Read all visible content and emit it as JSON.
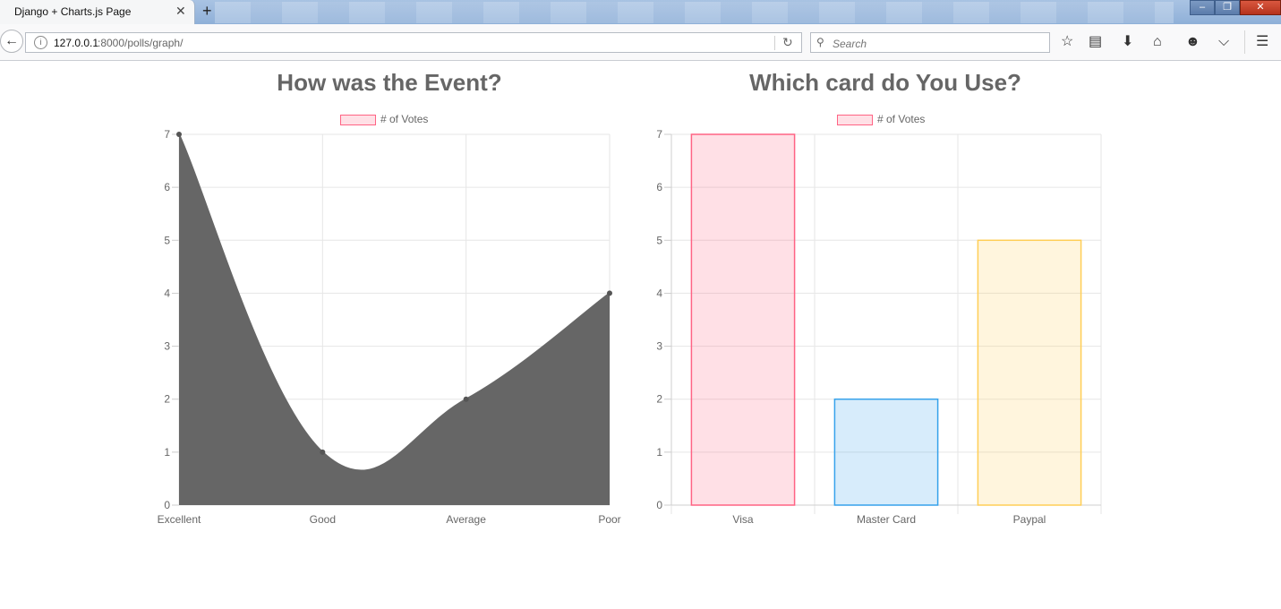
{
  "browser": {
    "tab_title": "Django + Charts.js Page",
    "tab_close": "✕",
    "new_tab": "+",
    "url_host": "127.0.0.1",
    "url_rest": ":8000/polls/graph/",
    "search_placeholder": "Search",
    "window_buttons": {
      "minimize": "–",
      "restore": "❐",
      "close": "✕"
    }
  },
  "icons": {
    "back": "back-arrow-icon",
    "info": "info-icon",
    "reload": "reload-icon",
    "search": "search-icon",
    "bookmark": "star-icon",
    "reading_list": "clipboard-icon",
    "download": "download-arrow-icon",
    "home": "home-icon",
    "hello": "smiley-icon",
    "pocket": "pocket-icon",
    "menu": "hamburger-menu-icon"
  },
  "chart_data": [
    {
      "type": "line",
      "title": "How was the Event?",
      "legend": "# of Votes",
      "categories": [
        "Excellent",
        "Good",
        "Average",
        "Poor"
      ],
      "series": [
        {
          "name": "# of Votes",
          "values": [
            7,
            1,
            2,
            4
          ]
        }
      ],
      "ylim": [
        0,
        7
      ],
      "yticks": [
        0,
        1,
        2,
        3,
        4,
        5,
        6,
        7
      ],
      "fill_color": "#666666",
      "grid": true,
      "legend_position": "top"
    },
    {
      "type": "bar",
      "title": "Which card do You Use?",
      "legend": "# of Votes",
      "categories": [
        "Visa",
        "Master Card",
        "Paypal"
      ],
      "series": [
        {
          "name": "# of Votes",
          "values": [
            7,
            2,
            5
          ]
        }
      ],
      "ylim": [
        0,
        7
      ],
      "yticks": [
        0,
        1,
        2,
        3,
        4,
        5,
        6,
        7
      ],
      "bar_fills": [
        "rgba(255,99,132,0.2)",
        "rgba(54,162,235,0.2)",
        "rgba(255,206,86,0.2)"
      ],
      "bar_borders": [
        "rgba(255,99,132,1)",
        "rgba(54,162,235,1)",
        "rgba(255,206,86,1)"
      ],
      "grid": true,
      "legend_position": "top"
    }
  ]
}
